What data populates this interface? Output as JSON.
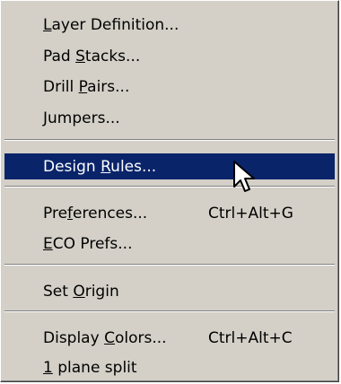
{
  "menu": {
    "items": [
      {
        "pre": "",
        "ul": "L",
        "post": "ayer Definition...",
        "shortcut": ""
      },
      {
        "pre": "Pad ",
        "ul": "S",
        "post": "tacks...",
        "shortcut": ""
      },
      {
        "pre": "Drill ",
        "ul": "P",
        "post": "airs...",
        "shortcut": ""
      },
      {
        "pre": "",
        "ul": "J",
        "post": "umpers...",
        "shortcut": ""
      },
      {
        "pre": "Design ",
        "ul": "R",
        "post": "ules...",
        "shortcut": ""
      },
      {
        "pre": "Pre",
        "ul": "f",
        "post": "erences...",
        "shortcut": "Ctrl+Alt+G"
      },
      {
        "pre": "",
        "ul": "E",
        "post": "CO Prefs...",
        "shortcut": ""
      },
      {
        "pre": "Set ",
        "ul": "O",
        "post": "rigin",
        "shortcut": ""
      },
      {
        "pre": "Display ",
        "ul": "C",
        "post": "olors...",
        "shortcut": "Ctrl+Alt+C"
      },
      {
        "pre": "",
        "ul": "1",
        "post": " plane split",
        "shortcut": ""
      }
    ],
    "highlighted_item": "Design Rules..."
  },
  "colors": {
    "menu_background": "#d4d0c8",
    "highlight_background": "#0a246a",
    "highlight_text": "#ffffff",
    "text": "#000000"
  },
  "icons": {
    "cursor": "arrow-pointer-icon"
  }
}
